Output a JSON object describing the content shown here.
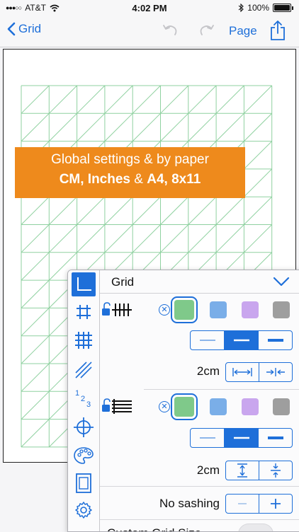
{
  "status_bar": {
    "carrier": "AT&T",
    "time": "4:02 PM",
    "battery": "100%",
    "icons": [
      "signal-dots-icon",
      "wifi-icon",
      "bluetooth-icon",
      "battery-icon"
    ]
  },
  "nav": {
    "back_label": "Grid",
    "page_label": "Page",
    "icons": [
      "chevron-left-icon",
      "undo-icon",
      "redo-icon",
      "share-icon"
    ]
  },
  "banner": {
    "line1": "Global settings & by paper",
    "line2_a": "CM, Inches",
    "line2_b": " & ",
    "line2_c": "A4, 8x11"
  },
  "panel": {
    "title": "Grid",
    "tool_icons": [
      "corner-axes-icon",
      "hash-grid-icon",
      "square-grid-icon",
      "diagonal-lines-icon",
      "numbers-123-icon",
      "crosshair-icon",
      "palette-icon",
      "page-frame-icon",
      "gear-icon"
    ],
    "vertical": {
      "size_label": "2cm",
      "colors": [
        "#7fc98a",
        "#7aaee8",
        "#c9a6ee",
        "#9e9e9e"
      ],
      "selected_color": 0,
      "line_weight_selected": 1
    },
    "horizontal": {
      "size_label": "2cm",
      "colors": [
        "#7fc98a",
        "#7aaee8",
        "#c9a6ee",
        "#9e9e9e"
      ],
      "selected_color": 0,
      "line_weight_selected": 1
    },
    "sashing_label": "No sashing",
    "custom_label": "Custom Grid Size"
  },
  "colors": {
    "accent": "#1e6fd9",
    "grid_line": "#8fd1a0",
    "banner": "#ee8a1c"
  }
}
